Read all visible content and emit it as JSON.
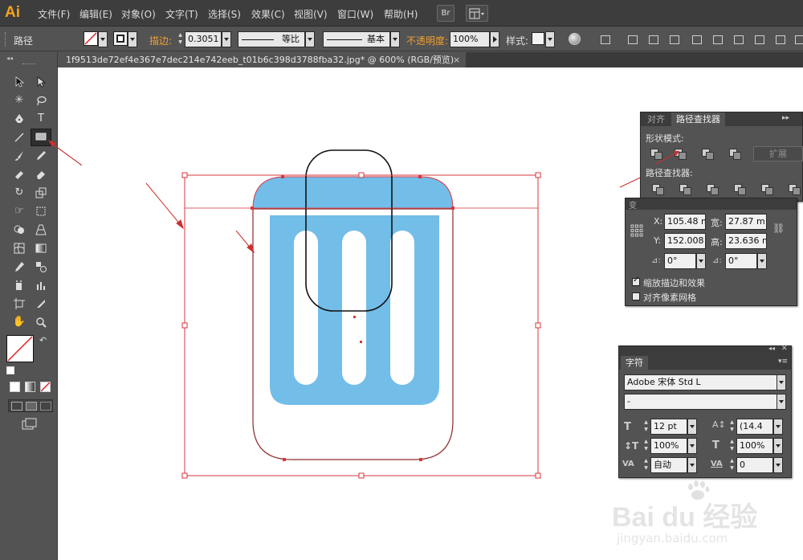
{
  "app": {
    "logo": "Ai"
  },
  "menu": {
    "file": "文件(F)",
    "edit": "编辑(E)",
    "object": "对象(O)",
    "type": "文字(T)",
    "select": "选择(S)",
    "effect": "效果(C)",
    "view": "视图(V)",
    "window": "窗口(W)",
    "help": "帮助(H)",
    "bridge": "Br"
  },
  "control": {
    "selection_label": "路径",
    "stroke_label": "描边:",
    "stroke_value": "0.3051",
    "profile_label": "等比",
    "brush_label": "基本",
    "opacity_label": "不透明度:",
    "opacity_value": "100%",
    "style_label": "样式:"
  },
  "document": {
    "tab_title": "1f9513de72ef4e367e7dec214e742eeb_t01b6c398d3788fba32.jpg* @ 600% (RGB/预览)",
    "close": "×"
  },
  "pathfinder": {
    "tab_align": "对齐",
    "tab_pathfinder": "路径查找器",
    "shape_modes_label": "形状模式:",
    "expand_label": "扩展",
    "pathfinders_label": "路径查找器:"
  },
  "transform": {
    "x_label": "X:",
    "x_value": "105.48 m",
    "w_label": "宽:",
    "w_value": "27.87 m",
    "y_label": "Y:",
    "y_value": "152.008",
    "h_label": "高:",
    "h_value": "23.636 m",
    "rotate_value": "0°",
    "shear_value": "0°",
    "scale_strokes_label": "缩放描边和效果",
    "align_pixel_label": "对齐像素网格"
  },
  "character": {
    "tab": "字符",
    "font_family": "Adobe 宋体 Std L",
    "font_style": "-",
    "size_value": "12 pt",
    "leading_value": "(14.4",
    "vscale_value": "100%",
    "hscale_value": "100%",
    "kerning_value": "自动",
    "tracking_value": "0"
  },
  "watermark": {
    "brand": "Bai du 经验",
    "url": "jingyan.baidu.com"
  },
  "colors": {
    "accent": "#f7a21b",
    "trash_blue": "#73bde9",
    "selection_red": "#d9363e",
    "arrow_red": "#cc2f2f"
  }
}
